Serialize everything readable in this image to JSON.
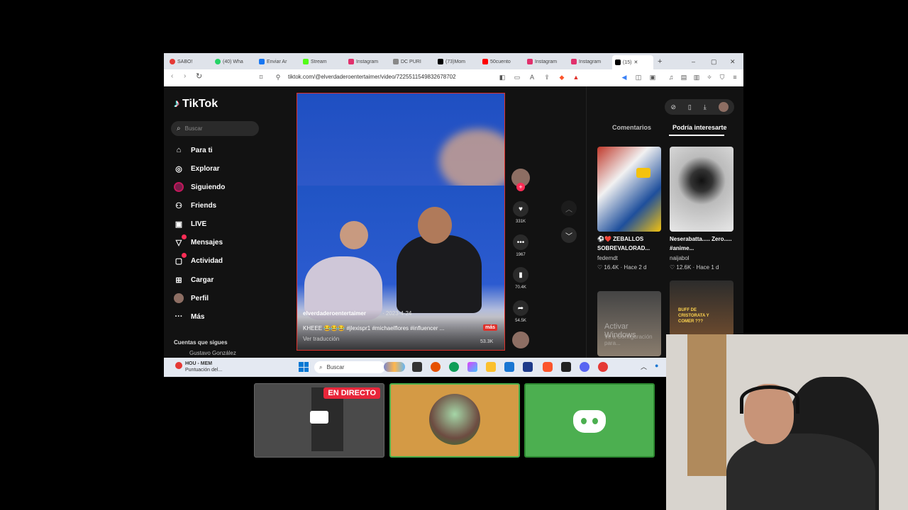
{
  "browser": {
    "tabs": [
      {
        "label": "SABO!",
        "color": "#e53935"
      },
      {
        "label": "(40) Wha",
        "color": "#25d366"
      },
      {
        "label": "Enviar Ar",
        "color": "#1877f2"
      },
      {
        "label": "Stream",
        "color": "#53fc18"
      },
      {
        "label": "Instagram",
        "color": "#e1306c"
      },
      {
        "label": "DC PURI",
        "color": "#888888"
      },
      {
        "label": "(73)Mom",
        "color": "#000000"
      },
      {
        "label": "50cuento",
        "color": "#ff0000"
      },
      {
        "label": "Instagram",
        "color": "#e1306c"
      },
      {
        "label": "Instagram",
        "color": "#e1306c"
      },
      {
        "label": "(15) ",
        "color": "#000000"
      }
    ],
    "new_tab": "+",
    "window_controls": [
      "–",
      "▢",
      "✕"
    ],
    "url": "tiktok.com/@elverdaderoentertaimer/video/7225511549832678702"
  },
  "tiktok": {
    "logo": "TikTok",
    "search_placeholder": "Buscar",
    "nav": [
      {
        "label": "Para ti",
        "icon": "home-icon"
      },
      {
        "label": "Explorar",
        "icon": "compass-icon"
      },
      {
        "label": "Siguiendo",
        "icon": "following-avatar"
      },
      {
        "label": "Friends",
        "icon": "friends-icon"
      },
      {
        "label": "LIVE",
        "icon": "live-icon"
      },
      {
        "label": "Mensajes",
        "icon": "messages-icon"
      },
      {
        "label": "Actividad",
        "icon": "activity-icon"
      },
      {
        "label": "Cargar",
        "icon": "upload-icon"
      },
      {
        "label": "Perfil",
        "icon": "profile-avatar"
      },
      {
        "label": "Más",
        "icon": "more-icon"
      }
    ],
    "following_title": "Cuentas que sigues",
    "following_account": "Gustavo González",
    "video": {
      "author": "elverdaderoentertaimer",
      "date": "· 2023-4-24",
      "caption": "KHEEE 😂😂😂 #jlexispr1 #michaelflores #influencer ...",
      "more": "más",
      "translate": "Ver traducción",
      "views": "53.3K"
    },
    "actions": {
      "likes": "331K",
      "comments": "1967",
      "saves": "70.4K",
      "shares": "54.5K"
    },
    "right_tabs": {
      "comments": "Comentarios",
      "suggested": "Podría interesarte"
    },
    "suggested": [
      {
        "title": "⚽❤️ ZEBALLOS SOBREVALORAD...",
        "author": "fedemdt",
        "likes": "♡ 16.4K",
        "time": "· Hace 2 d"
      },
      {
        "title": "Neserabatta..... Zero..... #anime...",
        "author": "naijabol",
        "likes": "♡ 12.6K",
        "time": "· Hace 1 d"
      }
    ],
    "thumb4_text": "BUFF DE CRISTORATA Y COMER ???",
    "watermark": "Activar Windows",
    "watermark2": "Ve a Configuración para..."
  },
  "taskbar": {
    "weather_title": "HOU - MEM",
    "weather_sub": "Puntuación del...",
    "search": "Buscar"
  },
  "stream": {
    "live_badge": "EN DIRECTO"
  }
}
